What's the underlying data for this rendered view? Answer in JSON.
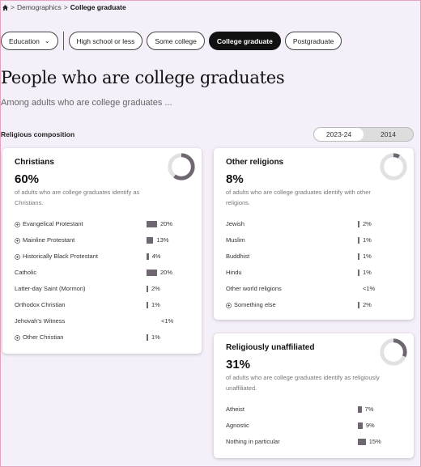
{
  "breadcrumb": {
    "sep1": ">",
    "link": "Demographics",
    "sep2": ">",
    "current": "College graduate"
  },
  "filters": {
    "dropdown_label": "Education",
    "options": [
      "High school or less",
      "Some college",
      "College graduate",
      "Postgraduate"
    ],
    "selected": "College graduate"
  },
  "page": {
    "title": "People who are college graduates",
    "subtitle": "Among adults who are college graduates ..."
  },
  "section_label": "Religious composition",
  "year_toggle": {
    "options": [
      "2023-24",
      "2014"
    ],
    "selected": "2023-24"
  },
  "colors": {
    "bar": "#6e6670",
    "donut_fill": "#6e6670",
    "donut_track": "#e1e1e3",
    "active_pill": "#111111",
    "background": "#f4eff9"
  },
  "cards": {
    "christians": {
      "title": "Christians",
      "percent": "60%",
      "share": 0.6,
      "description": "of adults who are college graduates identify as Christians.",
      "rows": [
        {
          "label": "Evangelical Protestant",
          "value": "20%",
          "pct": 20,
          "expandable": true
        },
        {
          "label": "Mainline Protestant",
          "value": "13%",
          "pct": 13,
          "expandable": true
        },
        {
          "label": "Historically Black Protestant",
          "value": "4%",
          "pct": 4,
          "expandable": true
        },
        {
          "label": "Catholic",
          "value": "20%",
          "pct": 20,
          "expandable": false
        },
        {
          "label": "Latter-day Saint (Mormon)",
          "value": "2%",
          "pct": 2,
          "expandable": false
        },
        {
          "label": "Orthodox Christian",
          "value": "1%",
          "pct": 1,
          "expandable": false
        },
        {
          "label": "Jehovah's Witness",
          "value": "<1%",
          "pct": 0,
          "expandable": false
        },
        {
          "label": "Other Christian",
          "value": "1%",
          "pct": 1,
          "expandable": true
        }
      ]
    },
    "other_religions": {
      "title": "Other religions",
      "percent": "8%",
      "share": 0.08,
      "description": "of adults who are college graduates identify with other religions.",
      "rows": [
        {
          "label": "Jewish",
          "value": "2%",
          "pct": 2,
          "expandable": false
        },
        {
          "label": "Muslim",
          "value": "1%",
          "pct": 1,
          "expandable": false
        },
        {
          "label": "Buddhist",
          "value": "1%",
          "pct": 1,
          "expandable": false
        },
        {
          "label": "Hindu",
          "value": "1%",
          "pct": 1,
          "expandable": false
        },
        {
          "label": "Other world religions",
          "value": "<1%",
          "pct": 0,
          "expandable": false
        },
        {
          "label": "Something else",
          "value": "2%",
          "pct": 2,
          "expandable": true
        }
      ]
    },
    "unaffiliated": {
      "title": "Religiously unaffiliated",
      "percent": "31%",
      "share": 0.31,
      "description": "of adults who are college graduates identify as religiously unaffiliated.",
      "rows": [
        {
          "label": "Atheist",
          "value": "7%",
          "pct": 7,
          "expandable": false
        },
        {
          "label": "Agnostic",
          "value": "9%",
          "pct": 9,
          "expandable": false
        },
        {
          "label": "Nothing in particular",
          "value": "15%",
          "pct": 15,
          "expandable": false
        }
      ]
    }
  }
}
